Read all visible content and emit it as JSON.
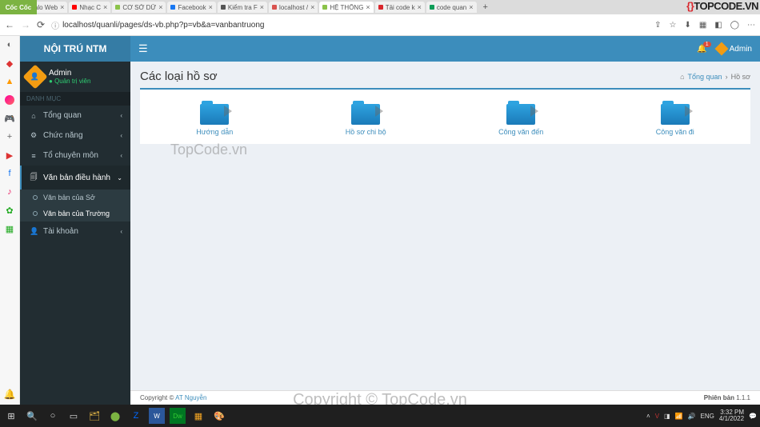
{
  "browser": {
    "brand": "Cốc Cốc",
    "tabs": [
      {
        "label": "Zalo Web",
        "icon_color": "#0068ff"
      },
      {
        "label": "Nhạc C",
        "icon_color": "#ff0000"
      },
      {
        "label": "CƠ SỞ DỮ",
        "icon_color": "#8bc34a"
      },
      {
        "label": "Facebook",
        "icon_color": "#1877f2"
      },
      {
        "label": "Kiểm tra F",
        "icon_color": "#555"
      },
      {
        "label": "localhost /",
        "icon_color": "#d9534f"
      },
      {
        "label": "HỆ THỐNG",
        "icon_color": "#8bc34a",
        "active": true
      },
      {
        "label": "Tải code k",
        "icon_color": "#d9272d"
      },
      {
        "label": "code quan",
        "icon_color": "#0f9d58"
      }
    ],
    "url": "localhost/quanli/pages/ds-vb.php?p=vb&a=vanbantruong"
  },
  "topcode_watermark": "TOPCODE.VN",
  "app": {
    "brand": "NỘI TRÚ NTM",
    "user": {
      "name": "Admin",
      "role": "Quản trị viên"
    },
    "section_header": "DANH MỤC",
    "menu": [
      {
        "icon": "⌂",
        "label": "Tổng quan",
        "caret": "‹"
      },
      {
        "icon": "⚙",
        "label": "Chức năng",
        "caret": "‹"
      },
      {
        "icon": "≡",
        "label": "Tổ chuyên môn",
        "caret": "‹"
      },
      {
        "icon": "🗐",
        "label": "Văn bản điều hành",
        "caret": "⌄",
        "active": true,
        "sub": [
          {
            "label": "Văn bản của Sở"
          },
          {
            "label": "Văn bản của Trường",
            "active": true
          }
        ]
      },
      {
        "icon": "👤",
        "label": "Tài khoản",
        "caret": "‹"
      }
    ],
    "topnav": {
      "notification_count": "1",
      "username": "Admin"
    },
    "page": {
      "title": "Các loại hồ sơ",
      "breadcrumb": {
        "home": "Tổng quan",
        "current": "Hồ sơ"
      },
      "folders": [
        {
          "label": "Hướng dẫn"
        },
        {
          "label": "Hồ sơ chi bộ"
        },
        {
          "label": "Công văn đến"
        },
        {
          "label": "Công văn đi"
        }
      ]
    },
    "watermark_text": "TopCode.vn",
    "overlay_text": "Copyright © TopCode.vn",
    "footer": {
      "copyright_prefix": "Copyright ©",
      "author": "AT Nguyễn",
      "version_label": "Phiên bản",
      "version": "1.1.1"
    }
  },
  "taskbar": {
    "tray_lang": "ENG",
    "time": "3:32 PM",
    "date": "4/1/2022"
  }
}
